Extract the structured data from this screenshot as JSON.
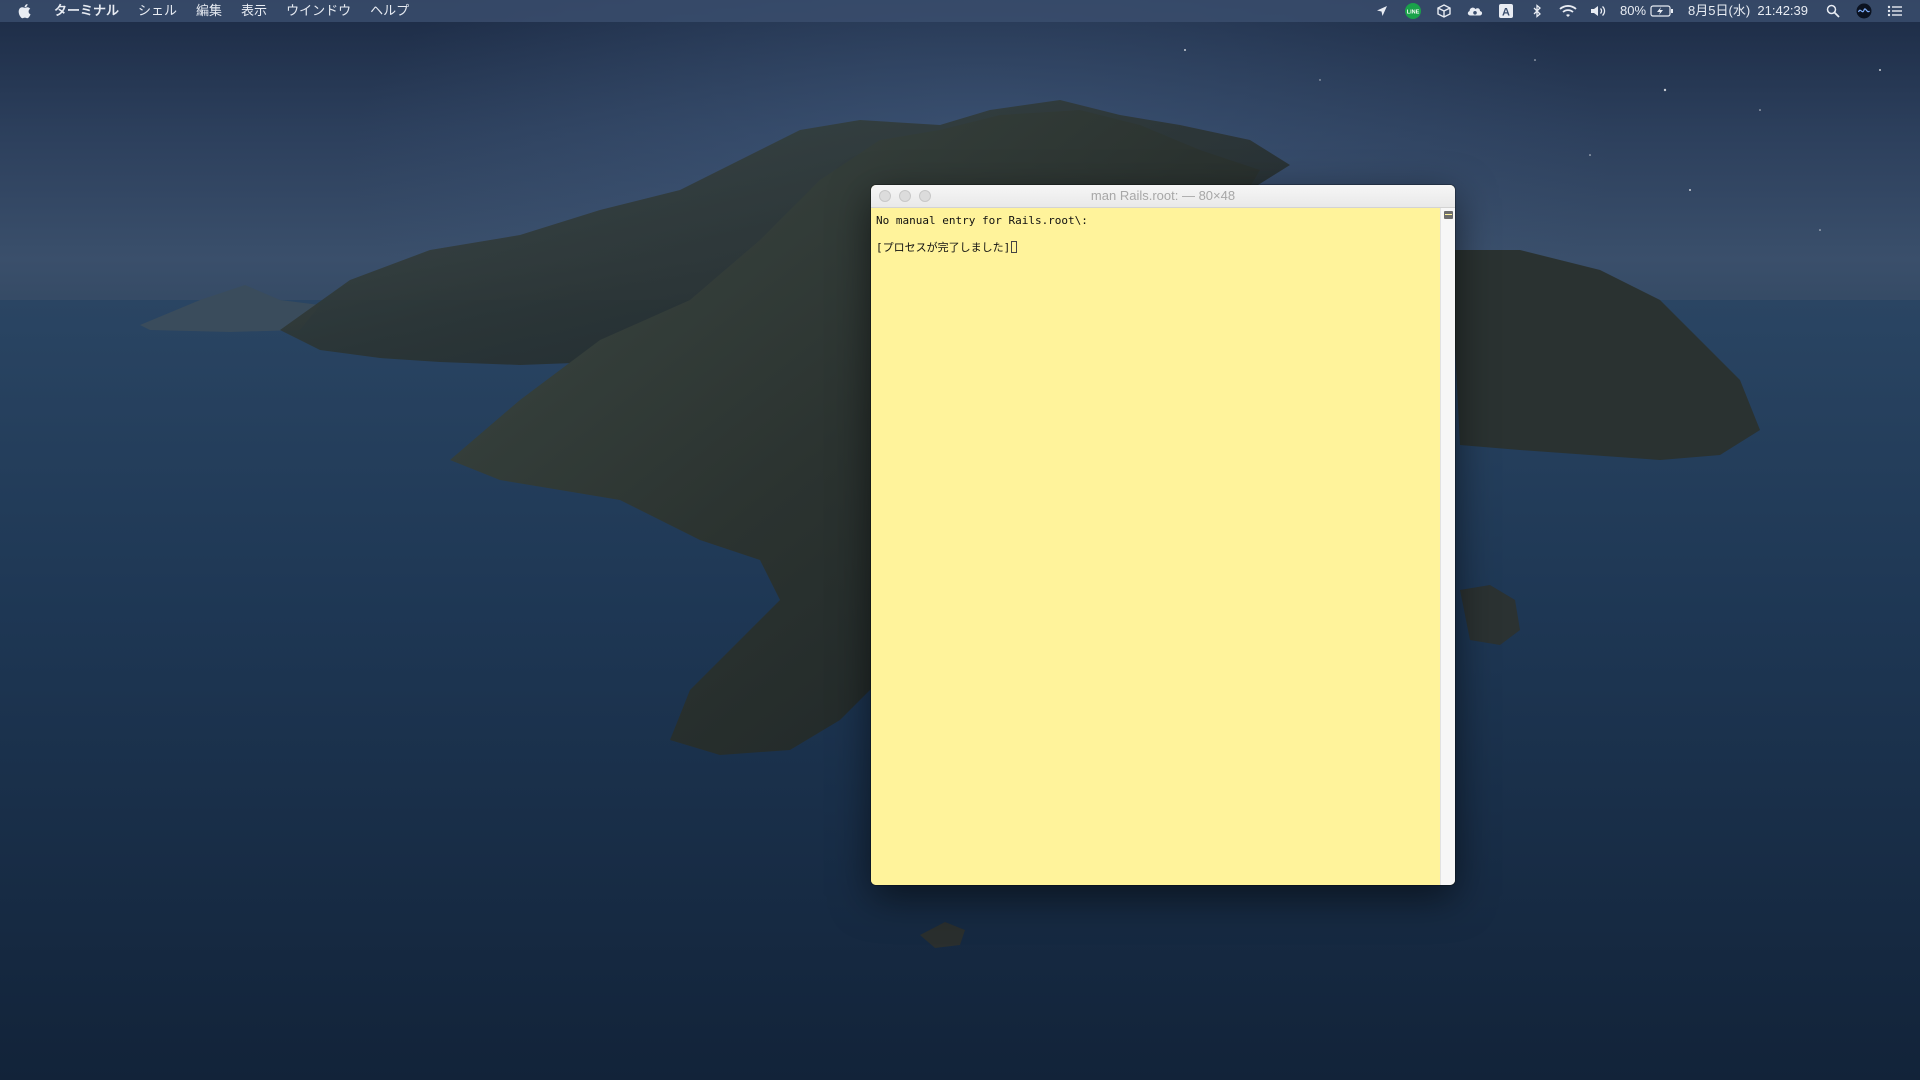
{
  "menubar": {
    "app_name": "ターミナル",
    "items": [
      "シェル",
      "編集",
      "表示",
      "ウインドウ",
      "ヘルプ"
    ],
    "battery": "80%",
    "datetime": "8月5日(水)  21:42:39",
    "status_icons": [
      "location-icon",
      "line-app-icon",
      "package-icon",
      "cloud-icon",
      "input-source-icon",
      "bluetooth-icon",
      "wifi-icon",
      "volume-icon",
      "battery-charging-icon",
      "spotlight-icon",
      "siri-icon",
      "notification-center-icon"
    ],
    "input_source_label": "A",
    "line_label": "LINE"
  },
  "terminal": {
    "title": "man Rails.root: — 80×48",
    "lines": [
      "No manual entry for Rails.root\\:",
      "",
      "[プロセスが完了しました]"
    ],
    "background_color": "#fff39b"
  }
}
